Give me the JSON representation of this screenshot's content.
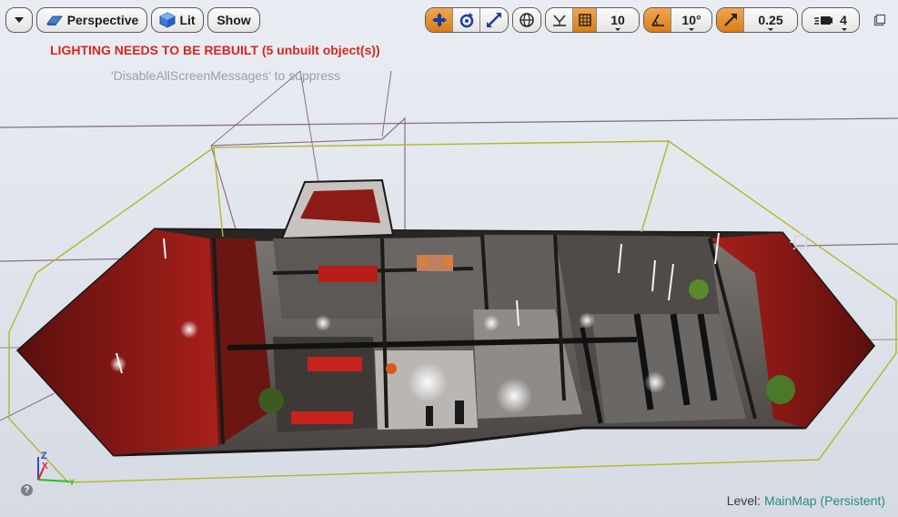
{
  "toolbar": {
    "menu_icon": "chevron-down-icon",
    "perspective_label": "Perspective",
    "lit_label": "Lit",
    "show_label": "Show",
    "transform_tools": [
      "move-icon",
      "rotate-icon",
      "scale-icon"
    ],
    "world_local_icon": "globe-icon",
    "surface_snap_icon": "surface-snap-icon",
    "grid_snap_icon": "grid-icon",
    "grid_snap_value": "10",
    "rotation_snap_icon": "angle-icon",
    "rotation_snap_value": "10°",
    "scale_snap_icon": "scale-snap-icon",
    "scale_snap_value": "0.25",
    "camera_speed_icon": "camera-speed-icon",
    "camera_speed_value": "4",
    "maximize_icon": "maximize-icon"
  },
  "messages": {
    "lighting_warning": "LIGHTING NEEDS TO BE REBUILT (5 unbuilt object(s))",
    "suppress_hint": "'DisableAllScreenMessages' to suppress"
  },
  "status": {
    "level_label": "Level:",
    "level_name": "MainMap (Persistent)"
  },
  "axis": {
    "x": "X",
    "y": "Y",
    "z": "Z"
  },
  "colors": {
    "accent_active": "#e08a2a",
    "warning": "#d8261c",
    "level_link": "#2a8a88",
    "bounds_yellow": "#b5b52a",
    "grid_lines": "#8a6a8a"
  }
}
